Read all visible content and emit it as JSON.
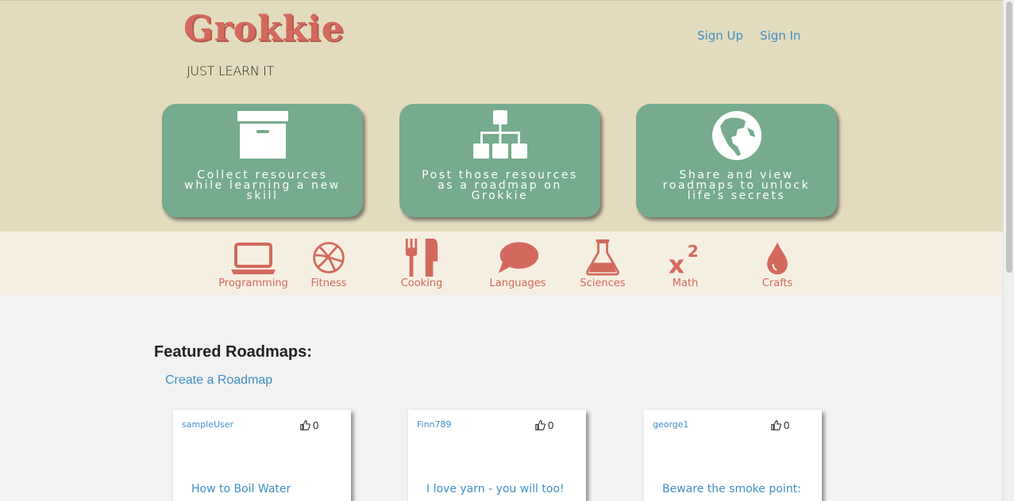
{
  "brand": {
    "logo": "Grokkie",
    "tagline": "JUST LEARN IT",
    "accent": "#d3695c"
  },
  "nav": {
    "signup": "Sign Up",
    "signin": "Sign In"
  },
  "features": [
    {
      "icon": "archive-box-icon",
      "text": "Collect resources while learning a new skill"
    },
    {
      "icon": "sitemap-icon",
      "text": "Post those resources as a roadmap on Grokkie"
    },
    {
      "icon": "globe-icon",
      "text": "Share and view roadmaps to unlock life's secrets"
    }
  ],
  "categories": [
    {
      "icon": "laptop-icon",
      "label": "Programming"
    },
    {
      "icon": "basketball-icon",
      "label": "Fitness"
    },
    {
      "icon": "fork-knife-icon",
      "label": "Cooking"
    },
    {
      "icon": "speech-bubble-icon",
      "label": "Languages"
    },
    {
      "icon": "flask-icon",
      "label": "Sciences"
    },
    {
      "icon": "superscript-icon",
      "label": "Math"
    },
    {
      "icon": "drop-icon",
      "label": "Crafts"
    }
  ],
  "featured": {
    "title": "Featured Roadmaps:",
    "create_link": "Create a Roadmap",
    "cards": [
      {
        "user": "sampleUser",
        "likes": "0",
        "title": "How to Boil Water"
      },
      {
        "user": "Finn789",
        "likes": "0",
        "title": "I love yarn - you will too!"
      },
      {
        "user": "george1",
        "likes": "0",
        "title": "Beware the smoke point:"
      }
    ]
  }
}
